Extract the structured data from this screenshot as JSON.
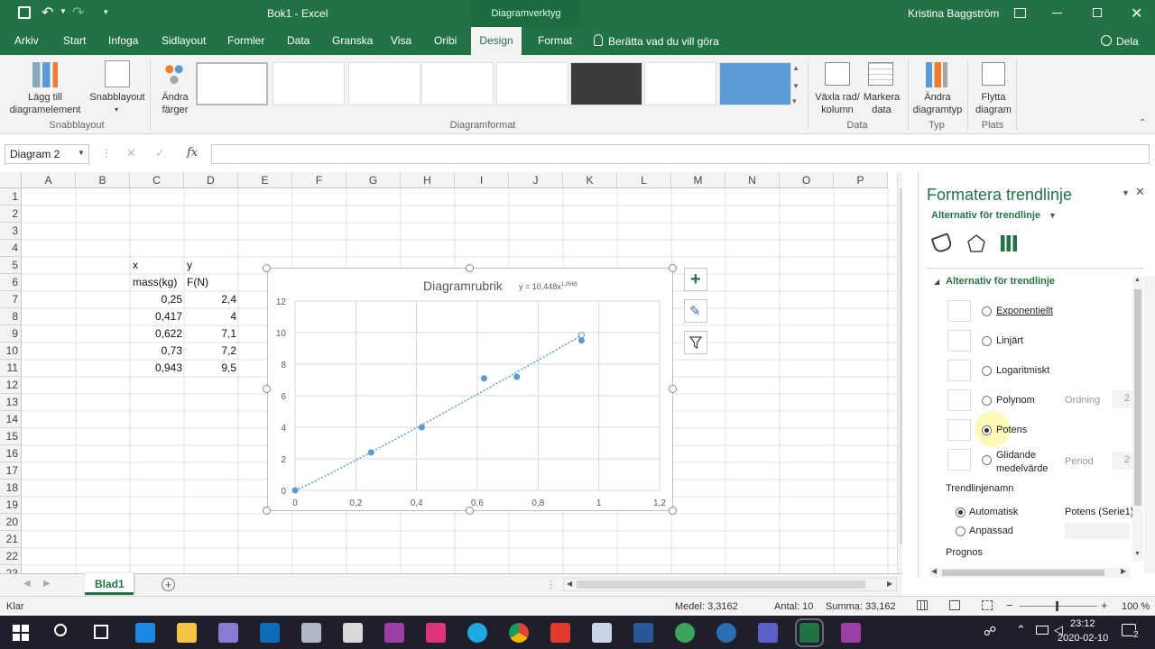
{
  "titlebar": {
    "workbook_title": "Bok1 - Excel",
    "context_label": "Diagramverktyg",
    "user": "Kristina Baggström"
  },
  "tabs": [
    "Arkiv",
    "Start",
    "Infoga",
    "Sidlayout",
    "Formler",
    "Data",
    "Granska",
    "Visa",
    "Oribi",
    "Design",
    "Format"
  ],
  "active_tab": "Design",
  "tell_me": "Berätta vad du vill göra",
  "share": "Dela",
  "ribbon": {
    "add_element": "Lägg till\ndiagramelement",
    "quick_layout": "Snabblayout",
    "change_colors": "Ändra\nfärger",
    "switch_row_col": "Växla rad/\nkolumn",
    "select_data": "Markera\ndata",
    "change_type": "Ändra\ndiagramtyp",
    "move_chart": "Flytta\ndiagram",
    "groups": {
      "quick_layout": "Snabblayout",
      "styles": "Diagramformat",
      "data": "Data",
      "type": "Typ",
      "location": "Plats"
    }
  },
  "formula": {
    "namebox": "Diagram 2",
    "fx": "fx",
    "value": ""
  },
  "columns": [
    "A",
    "B",
    "C",
    "D",
    "E",
    "F",
    "G",
    "H",
    "I",
    "J",
    "K",
    "L",
    "M",
    "N",
    "O",
    "P"
  ],
  "rows": [
    "1",
    "2",
    "3",
    "4",
    "5",
    "6",
    "7",
    "8",
    "9",
    "10",
    "11",
    "12",
    "13",
    "14",
    "15",
    "16",
    "17",
    "18",
    "19",
    "20",
    "21",
    "22",
    "23"
  ],
  "cells": {
    "C5": "x",
    "D5": "y",
    "C6": "mass(kg)",
    "D6": "F(N)",
    "C7": "0,25",
    "D7": "2,4",
    "C8": "0,417",
    "D8": "4",
    "C9": "0,622",
    "D9": "7,1",
    "C10": "0,73",
    "D10": "7,2",
    "C11": "0,943",
    "D11": "9,5"
  },
  "chart_data": {
    "type": "scatter",
    "title": "Diagramrubrik",
    "trendline_equation": "y = 10,448x^1,0565",
    "trendline": {
      "kind": "power",
      "a": 10.448,
      "b": 1.0565
    },
    "x": [
      0,
      0.25,
      0.417,
      0.622,
      0.73,
      0.943,
      0.943
    ],
    "y": [
      0,
      2.4,
      4,
      7.1,
      7.2,
      9.5,
      9.85
    ],
    "xlim": [
      0,
      1.2
    ],
    "ylim": [
      0,
      12
    ],
    "x_ticks": [
      "0",
      "0,2",
      "0,4",
      "0,6",
      "0,8",
      "1",
      "1,2"
    ],
    "y_ticks": [
      "0",
      "2",
      "4",
      "6",
      "8",
      "10",
      "12"
    ],
    "grid": true,
    "point_color": "#5b9bd5"
  },
  "panel": {
    "title": "Formatera trendlinje",
    "subtitle": "Alternativ för trendlinje",
    "section": "Alternativ för trendlinje",
    "options": [
      "Exponentiellt",
      "Linjärt",
      "Logaritmiskt",
      "Polynom",
      "Potens",
      "Glidande\nmedelvärde"
    ],
    "selected_option": "Potens",
    "order_label": "Ordning",
    "order_value": "2",
    "period_label": "Period",
    "period_value": "2",
    "name_header": "Trendlinjenamn",
    "auto_label": "Automatisk",
    "auto_value": "Potens (Serie1)",
    "custom_label": "Anpassad",
    "forecast": "Prognos"
  },
  "sheet_tab": "Blad1",
  "status": {
    "ready": "Klar",
    "average": "Medel: 3,3162",
    "count": "Antal: 10",
    "sum": "Summa: 33,162",
    "zoom": "100 %"
  },
  "taskbar": {
    "time": "23:12",
    "date": "2020-02-10",
    "notifications": "2"
  },
  "colors": {
    "excel_green": "#217346",
    "accent_blue": "#5b9bd5"
  }
}
